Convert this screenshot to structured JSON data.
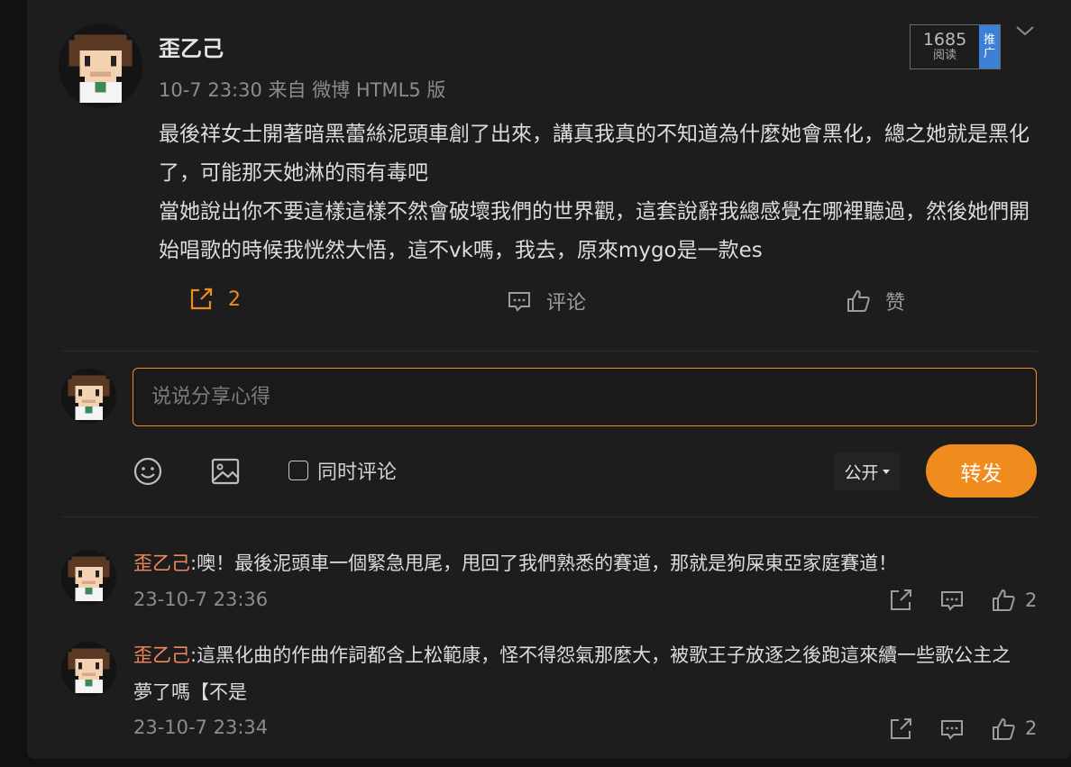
{
  "post": {
    "author": "歪乙己",
    "meta": "10-7 23:30 来自 微博 HTML5 版",
    "body_line1": "最後祥女士開著暗黑蕾絲泥頭車創了出來，講真我真的不知道為什麼她會黑化，總之她就是黑化了，可能那天她淋的雨有毒吧",
    "body_line2": "當她說出你不要這樣這樣不然會破壞我們的世界觀，這套說辭我總感覺在哪裡聽過，然後她們開始唱歌的時候我恍然大悟，這不vk嗎，我去，原來mygo是一款es",
    "read_count": "1685",
    "read_label": "阅读",
    "promote_label_1": "推",
    "promote_label_2": "广",
    "repost_count": "2",
    "comment_label": "评论",
    "like_label": "赞"
  },
  "composer": {
    "placeholder": "说说分享心得",
    "also_comment_label": "同时评论",
    "visibility_label": "公开",
    "submit_label": "转发"
  },
  "comments": [
    {
      "name": "歪乙己",
      "text": ":噢！最後泥頭車一個緊急甩尾，甩回了我們熟悉的賽道，那就是狗屎東亞家庭賽道！",
      "time": "23-10-7 23:36",
      "likes": "2"
    },
    {
      "name": "歪乙己",
      "text": ":這黑化曲的作曲作詞都含上松範康，怪不得怨氣那麼大，被歌王子放逐之後跑這來續一些歌公主之夢了嗎【不是",
      "time": "23-10-7 23:34",
      "likes": "2"
    }
  ],
  "colors": {
    "accent": "#f08b1e",
    "commenter_name": "#f0885c",
    "promote_badge": "#3b7fd6"
  },
  "icons": [
    "avatar-pixel-art",
    "chevron-down-icon",
    "repost-icon",
    "comment-icon",
    "like-icon",
    "emoji-icon",
    "image-icon",
    "dropdown-triangle-icon"
  ]
}
